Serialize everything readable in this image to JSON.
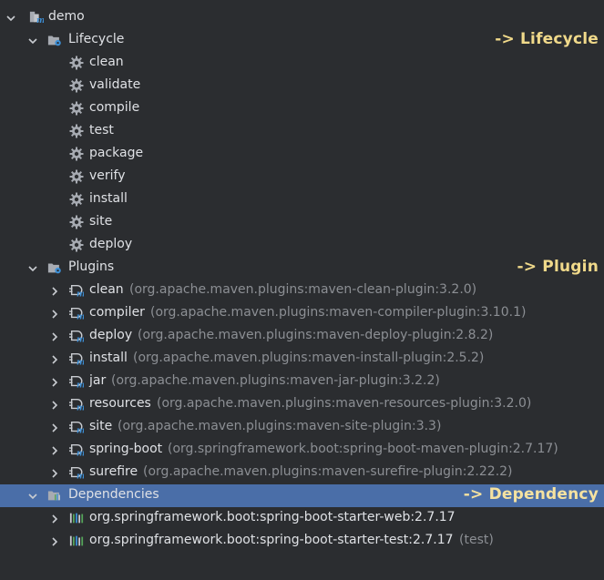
{
  "tree": {
    "root": {
      "label": "demo"
    },
    "lifecycle": {
      "label": "Lifecycle",
      "annotation": "-> Lifecycle",
      "items": [
        "clean",
        "validate",
        "compile",
        "test",
        "package",
        "verify",
        "install",
        "site",
        "deploy"
      ]
    },
    "plugins": {
      "label": "Plugins",
      "annotation": "-> Plugin",
      "items": [
        {
          "name": "clean",
          "coord": "(org.apache.maven.plugins:maven-clean-plugin:3.2.0)"
        },
        {
          "name": "compiler",
          "coord": "(org.apache.maven.plugins:maven-compiler-plugin:3.10.1)"
        },
        {
          "name": "deploy",
          "coord": "(org.apache.maven.plugins:maven-deploy-plugin:2.8.2)"
        },
        {
          "name": "install",
          "coord": "(org.apache.maven.plugins:maven-install-plugin:2.5.2)"
        },
        {
          "name": "jar",
          "coord": "(org.apache.maven.plugins:maven-jar-plugin:3.2.2)"
        },
        {
          "name": "resources",
          "coord": "(org.apache.maven.plugins:maven-resources-plugin:3.2.0)"
        },
        {
          "name": "site",
          "coord": "(org.apache.maven.plugins:maven-site-plugin:3.3)"
        },
        {
          "name": "spring-boot",
          "coord": "(org.springframework.boot:spring-boot-maven-plugin:2.7.17)"
        },
        {
          "name": "surefire",
          "coord": "(org.apache.maven.plugins:maven-surefire-plugin:2.22.2)"
        }
      ]
    },
    "dependencies": {
      "label": "Dependencies",
      "annotation": "-> Dependency",
      "items": [
        {
          "name": "org.springframework.boot:spring-boot-starter-web:2.7.17",
          "scope": ""
        },
        {
          "name": "org.springframework.boot:spring-boot-starter-test:2.7.17",
          "scope": "(test)"
        }
      ]
    }
  },
  "colors": {
    "background": "#2b2d30",
    "selection": "#4a6ea8",
    "text": "#dfe1e5",
    "muted_text": "#8c8f94",
    "annotation": "#f0d98a",
    "maven_icon_blue": "#3d8fd6"
  },
  "icons": {
    "root": "maven-module-icon",
    "lifecycle": "folder-gear-icon",
    "goal": "gear-icon",
    "plugins": "folder-gear-icon",
    "plugin": "plugin-icon",
    "dependencies": "library-folder-icon",
    "dependency": "library-icon",
    "expanded": "chevron-down-icon",
    "collapsed": "chevron-right-icon"
  }
}
